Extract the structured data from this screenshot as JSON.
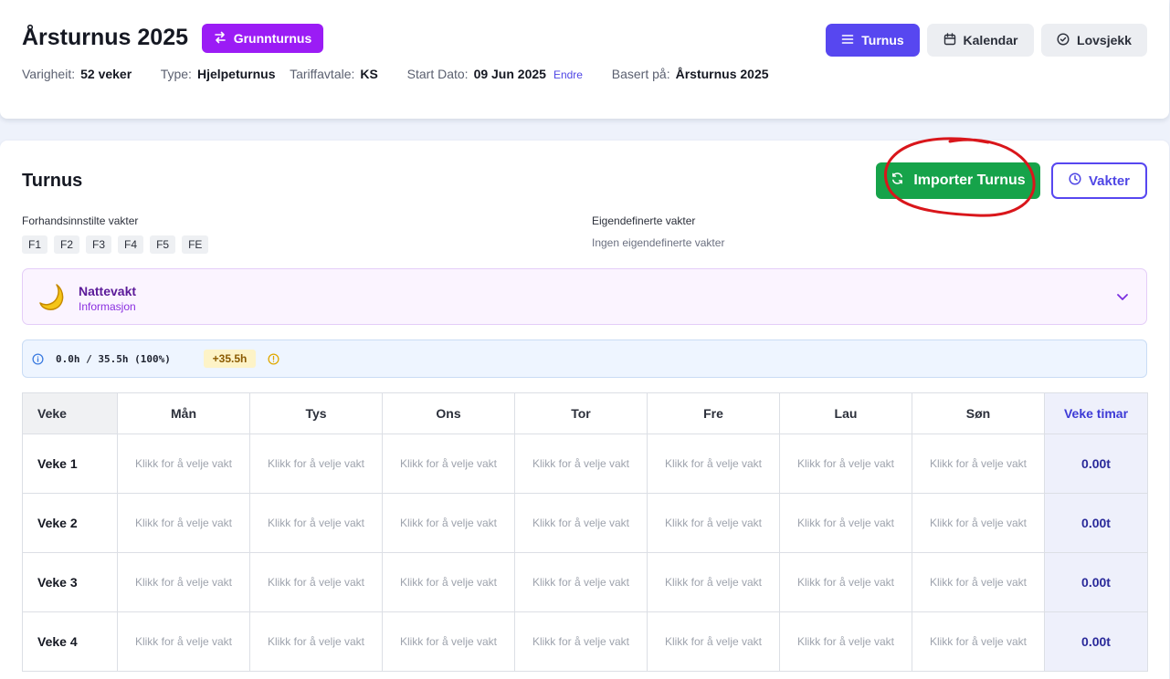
{
  "header": {
    "title": "Årsturnus 2025",
    "grunnturnus_label": "Grunnturnus",
    "varighet_label": "Varigheit:",
    "varighet_value": "52 veker",
    "type_label": "Type:",
    "type_value": "Hjelpeturnus",
    "tariff_label": "Tariffavtale:",
    "tariff_value": "KS",
    "start_label": "Start Dato:",
    "start_value": "09 Jun 2025",
    "endre_label": "Endre",
    "basert_label": "Basert på:",
    "basert_value": "Årsturnus 2025",
    "tabs": {
      "turnus": "Turnus",
      "kalendar": "Kalendar",
      "lovsjekk": "Lovsjekk"
    }
  },
  "turnus": {
    "title": "Turnus",
    "import_label": "Importer Turnus",
    "vakter_label": "Vakter",
    "preset_label": "Forhandsinnstilte vakter",
    "preset_chips": [
      "F1",
      "F2",
      "F3",
      "F4",
      "F5",
      "FE"
    ],
    "custom_label": "Eigendefinerte vakter",
    "custom_empty": "Ingen eigendefinerte vakter",
    "natt_title": "Nattevakt",
    "natt_sub": "Informasjon",
    "hours_text": "0.0h / 35.5h (100%)",
    "hours_badge": "+35.5h"
  },
  "table": {
    "week_header": "Veke",
    "days": [
      "Mån",
      "Tys",
      "Ons",
      "Tor",
      "Fre",
      "Lau",
      "Søn"
    ],
    "total_header": "Veke timar",
    "cell_placeholder": "Klikk for å velje vakt",
    "rows": [
      {
        "week": "Veke 1",
        "total": "0.00t"
      },
      {
        "week": "Veke 2",
        "total": "0.00t"
      },
      {
        "week": "Veke 3",
        "total": "0.00t"
      },
      {
        "week": "Veke 4",
        "total": "0.00t"
      }
    ]
  },
  "colors": {
    "primary": "#5747f0",
    "import_green": "#16a34a",
    "grunnturnus_purple": "#9b1cf5",
    "annotation_red": "#d9161b"
  }
}
